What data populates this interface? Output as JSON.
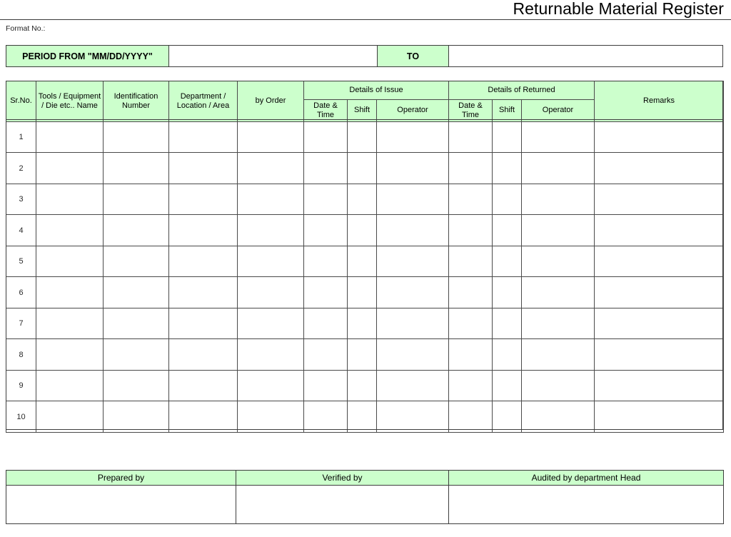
{
  "document": {
    "title": "Returnable Material Register",
    "format_no_label": "Format No.:"
  },
  "period": {
    "label": "PERIOD FROM \"MM/DD/YYYY\"",
    "from_value": "",
    "to_label": "TO",
    "to_value": ""
  },
  "register": {
    "group_headers": {
      "sr_no": "Sr.No.",
      "tool_name": "Tools / Equipment / Die etc.. Name",
      "identification_number": "Identification Number",
      "department": "Department / Location / Area",
      "by_order": "by Order",
      "details_of_issue": "Details of Issue",
      "details_of_returned": "Details of Returned",
      "remarks": "Remarks"
    },
    "sub_headers": {
      "issue_date_time": "Date & Time",
      "issue_shift": "Shift",
      "issue_operator": "Operator",
      "returned_date_time": "Date & Time",
      "returned_shift": "Shift",
      "returned_operator": "Operator"
    },
    "rows": [
      {
        "sr_no": "1",
        "tool_name": "",
        "identification_number": "",
        "department": "",
        "by_order": "",
        "issue_date_time": "",
        "issue_shift": "",
        "issue_operator": "",
        "returned_date_time": "",
        "returned_shift": "",
        "returned_operator": "",
        "remarks": ""
      },
      {
        "sr_no": "2",
        "tool_name": "",
        "identification_number": "",
        "department": "",
        "by_order": "",
        "issue_date_time": "",
        "issue_shift": "",
        "issue_operator": "",
        "returned_date_time": "",
        "returned_shift": "",
        "returned_operator": "",
        "remarks": ""
      },
      {
        "sr_no": "3",
        "tool_name": "",
        "identification_number": "",
        "department": "",
        "by_order": "",
        "issue_date_time": "",
        "issue_shift": "",
        "issue_operator": "",
        "returned_date_time": "",
        "returned_shift": "",
        "returned_operator": "",
        "remarks": ""
      },
      {
        "sr_no": "4",
        "tool_name": "",
        "identification_number": "",
        "department": "",
        "by_order": "",
        "issue_date_time": "",
        "issue_shift": "",
        "issue_operator": "",
        "returned_date_time": "",
        "returned_shift": "",
        "returned_operator": "",
        "remarks": ""
      },
      {
        "sr_no": "5",
        "tool_name": "",
        "identification_number": "",
        "department": "",
        "by_order": "",
        "issue_date_time": "",
        "issue_shift": "",
        "issue_operator": "",
        "returned_date_time": "",
        "returned_shift": "",
        "returned_operator": "",
        "remarks": ""
      },
      {
        "sr_no": "6",
        "tool_name": "",
        "identification_number": "",
        "department": "",
        "by_order": "",
        "issue_date_time": "",
        "issue_shift": "",
        "issue_operator": "",
        "returned_date_time": "",
        "returned_shift": "",
        "returned_operator": "",
        "remarks": ""
      },
      {
        "sr_no": "7",
        "tool_name": "",
        "identification_number": "",
        "department": "",
        "by_order": "",
        "issue_date_time": "",
        "issue_shift": "",
        "issue_operator": "",
        "returned_date_time": "",
        "returned_shift": "",
        "returned_operator": "",
        "remarks": ""
      },
      {
        "sr_no": "8",
        "tool_name": "",
        "identification_number": "",
        "department": "",
        "by_order": "",
        "issue_date_time": "",
        "issue_shift": "",
        "issue_operator": "",
        "returned_date_time": "",
        "returned_shift": "",
        "returned_operator": "",
        "remarks": ""
      },
      {
        "sr_no": "9",
        "tool_name": "",
        "identification_number": "",
        "department": "",
        "by_order": "",
        "issue_date_time": "",
        "issue_shift": "",
        "issue_operator": "",
        "returned_date_time": "",
        "returned_shift": "",
        "returned_operator": "",
        "remarks": ""
      },
      {
        "sr_no": "10",
        "tool_name": "",
        "identification_number": "",
        "department": "",
        "by_order": "",
        "issue_date_time": "",
        "issue_shift": "",
        "issue_operator": "",
        "returned_date_time": "",
        "returned_shift": "",
        "returned_operator": "",
        "remarks": ""
      }
    ]
  },
  "signatures": {
    "columns": [
      {
        "label": "Prepared by",
        "value": ""
      },
      {
        "label": "Verified by",
        "value": ""
      },
      {
        "label": "Audited by department Head",
        "value": ""
      }
    ]
  },
  "colors": {
    "header_green": "#ccffcc",
    "border": "#3d3d3d",
    "grid": "#4a4a4a",
    "text": "#000000",
    "page_background": "#ffffff"
  }
}
